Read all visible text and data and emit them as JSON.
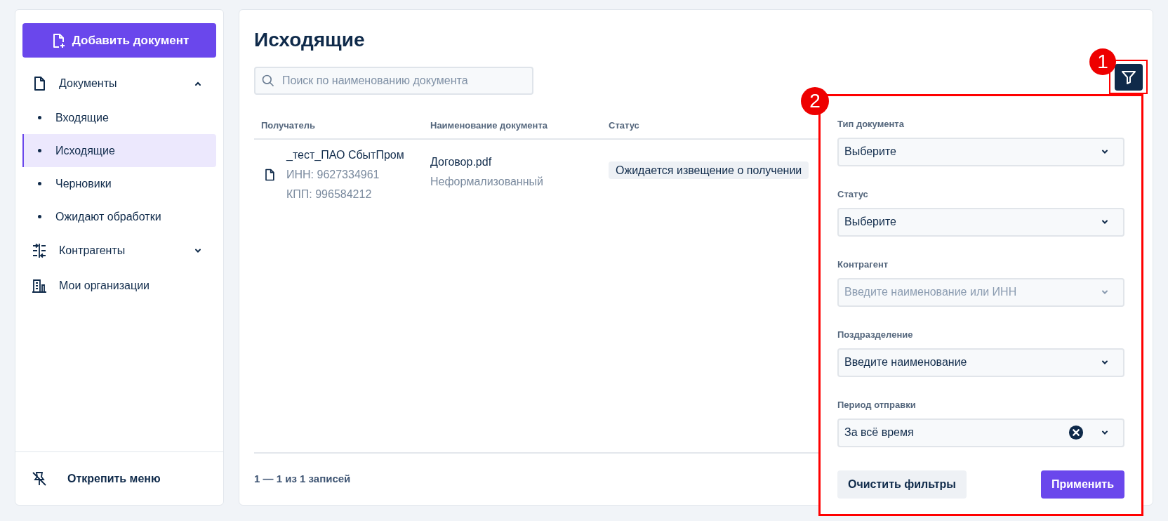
{
  "sidebar": {
    "add_button": "Добавить документ",
    "items": [
      {
        "kind": "documents",
        "label": "Документы",
        "expanded": true,
        "children": [
          {
            "label": "Входящие",
            "selected": false
          },
          {
            "label": "Исходящие",
            "selected": true
          },
          {
            "label": "Черновики",
            "selected": false
          },
          {
            "label": "Ожидают обработки",
            "selected": false
          }
        ]
      },
      {
        "kind": "counterparties",
        "label": "Контрагенты",
        "expanded": false
      },
      {
        "kind": "organizations",
        "label": "Мои организации"
      }
    ],
    "unpin": "Открепить меню"
  },
  "page": {
    "title": "Исходящие",
    "search": {
      "placeholder": "Поиск по наименованию документа"
    },
    "table": {
      "columns": [
        "Получатель",
        "Наименование документа",
        "Статус"
      ],
      "rows": [
        {
          "recipient": "_тест_ПАО СбытПром",
          "inn": "ИНН: 9627334961",
          "kpp": "КПП: 996584212",
          "document": "Договор.pdf",
          "doc_type": "Неформализованный",
          "status": "Ожидается извещение о получении"
        }
      ]
    },
    "pagination": "1 — 1 из 1 записей"
  },
  "filter_panel": {
    "fields": [
      {
        "label": "Тип документа",
        "value": "Выберите",
        "clearable": false
      },
      {
        "label": "Статус",
        "value": "Выберите",
        "clearable": false
      },
      {
        "label": "Контрагент",
        "placeholder": "Введите наименование или ИНН",
        "clearable": false
      },
      {
        "label": "Поздразделение",
        "value": "Введите наименование",
        "clearable": false
      },
      {
        "label": "Период отправки",
        "value": "За всё время",
        "clearable": true
      }
    ],
    "clear_button": "Очистить фильтры",
    "apply_button": "Применить"
  },
  "annotations": [
    "1",
    "2"
  ]
}
